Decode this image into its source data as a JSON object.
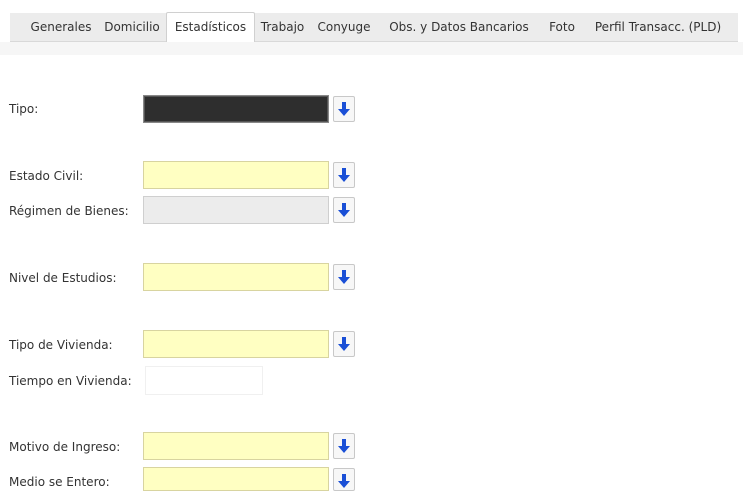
{
  "tabs": [
    {
      "label": "Generales"
    },
    {
      "label": "Domicilio"
    },
    {
      "label": "Estadísticos"
    },
    {
      "label": "Trabajo"
    },
    {
      "label": "Conyuge"
    },
    {
      "label": "Obs. y Datos Bancarios"
    },
    {
      "label": "Foto"
    },
    {
      "label": "Perfil Transacc. (PLD)"
    }
  ],
  "active_tab": "Estadísticos",
  "form": {
    "tipo": {
      "label": "Tipo:"
    },
    "estado_civil": {
      "label": "Estado Civil:"
    },
    "regimen_bienes": {
      "label": "Régimen de Bienes:"
    },
    "nivel_estudios": {
      "label": "Nivel de Estudios:"
    },
    "tipo_vivienda": {
      "label": "Tipo de Vivienda:"
    },
    "tiempo_vivienda": {
      "label": "Tiempo en Vivienda:"
    },
    "motivo_ingreso": {
      "label": "Motivo de Ingreso:"
    },
    "medio_entero": {
      "label": "Medio se Entero:"
    }
  },
  "icons": {
    "dropdown": "arrow-down-icon"
  },
  "colors": {
    "field_required": "#ffffc2",
    "field_disabled": "#ececec",
    "field_dark": "#2e2e2e",
    "arrow": "#1a4fd6"
  }
}
